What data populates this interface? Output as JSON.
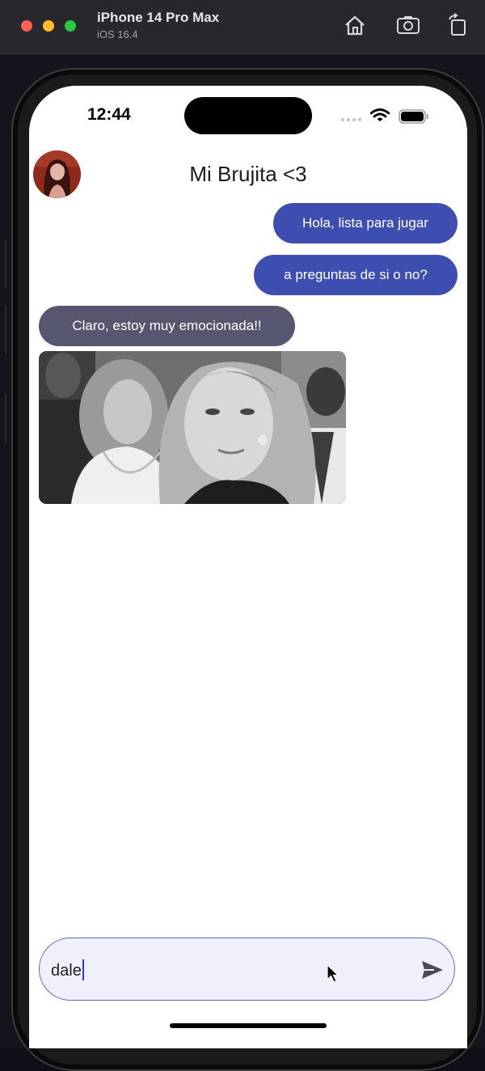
{
  "simulator": {
    "device_name": "iPhone 14 Pro Max",
    "os_version": "iOS 16.4",
    "icons": [
      "home-icon",
      "screenshot-icon",
      "rotate-icon"
    ]
  },
  "status_bar": {
    "time": "12:44",
    "icons": [
      "wifi-icon",
      "battery-icon"
    ]
  },
  "chat": {
    "title": "Mi Brujita <3",
    "messages": [
      {
        "from": "me",
        "text": "Hola, lista para jugar"
      },
      {
        "from": "me",
        "text": "a preguntas de si o no?"
      },
      {
        "from": "them",
        "text": "Claro, estoy muy emocionada!!"
      },
      {
        "from": "them",
        "type": "gif"
      }
    ]
  },
  "composer": {
    "value": "dale",
    "send_icon": "send-icon"
  },
  "colors": {
    "sent_bubble": "#3d4eb0",
    "received_bubble": "#565670",
    "composer_bg": "#eff0fb",
    "composer_border": "#5a68b6"
  }
}
